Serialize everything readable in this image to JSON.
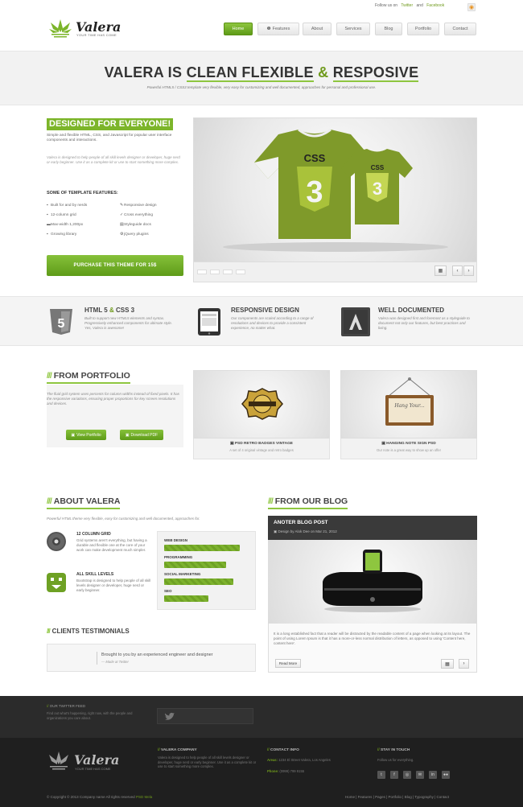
{
  "top": {
    "follow": "Follow us on",
    "twitter": "Twitter",
    "and": "and",
    "facebook": "Facebook"
  },
  "logo": {
    "name": "Valera",
    "tagline": "YOUR TIME HAS COME"
  },
  "nav": [
    "Home",
    "Features",
    "About",
    "Services",
    "Blog",
    "Portfolio",
    "Contact"
  ],
  "hero": {
    "pre": "VALERA IS ",
    "w1": "CLEAN FLEXIBLE",
    "amp": " & ",
    "w2": "RESPOSIVE",
    "subtitle": "Powerful HTML5 / CSS3 template very flexible, very easy for customizing and well documented, approaches for personal and professional use."
  },
  "intro": {
    "heading": "DESIGNED FOR EVERYONE!",
    "p1": "Simple and flexible HTML, CSS, and Javascript for popular user interface components and interactions.",
    "p2": "Valera is designed to help people of all skill levels designer or developer, huge nerd or early beginner. Use it as a complete kit or use to start something more complex.",
    "features_title": "SOME OF TEMPLATE FEATURES:",
    "features": [
      "Built for and by nerds",
      "Responsive design",
      "12-column grid",
      "Cross everything",
      "Max-width 1,200px",
      "Styleguide docs",
      "Growing library",
      "jQuery plugins"
    ],
    "buy": "PURCHASE THIS THEME FOR 15$"
  },
  "band": [
    {
      "title": "HTML 5",
      "title2": "CSS 3",
      "text": "Built to support new HTML5 elements and syntax. Progressively enhanced components for ultimate style. Yes, Valera is awesome!"
    },
    {
      "title": "RESPONSIVE DESIGN",
      "text": "Our components are scaled according to a range of resolutions and devices to provide a consistent experience, no matter what."
    },
    {
      "title": "WELL DOCUMENTED",
      "text": "Valera was designed first and foremost as a styleguide to document not only our features, but best practices and living."
    }
  ],
  "portfolio": {
    "heading": "FROM PORTFOLIO",
    "text": "The fluid grid system uses percents for column widths instead of fixed pixels. It has the responsive variations, ensuring proper proportions for key screen resolutions and devices.",
    "btn1": "View Portfolio",
    "btn2": "Download PDF",
    "items": [
      {
        "title": "PSD RETRO BADGES VINTAGE",
        "sub": "A set of 4 original vintage and retro badges"
      },
      {
        "title": "HANGING NOTE SIGN PSD",
        "sub": "Our note is a great way to show up an offer"
      }
    ],
    "sign": "Hang Your..."
  },
  "about": {
    "heading": "ABOUT VALERA",
    "sub": "Powerful HTML theme very flexible, easy for customizing and well documented, approaches for.",
    "items": [
      {
        "title": "12 COLUMN GRID",
        "text": "Grid systems aren't everything, but having a durable and flexible one at the core of your work can make development much simpler."
      },
      {
        "title": "ALL SKILL LEVELS",
        "text": "Bootstrap is designed to help people of all skill levels designer or developer, huge nerd or early beginner."
      }
    ],
    "skills": [
      {
        "name": "WEB DESIGN",
        "pct": 85
      },
      {
        "name": "PROGRAMMING",
        "pct": 70
      },
      {
        "name": "SOCIAL MARKETING",
        "pct": 78
      },
      {
        "name": "SEO",
        "pct": 50
      }
    ]
  },
  "testimonials": {
    "heading": "CLIENTS TESTIMONIALS",
    "quote": "Brought to you by an experienced engineer and designer",
    "author": "— Made at Twitter"
  },
  "blog": {
    "heading": "FROM OUR BLOG",
    "post_title": "ANOTER BLOG POST",
    "meta": "Design by Alok Dee on Mar 21, 2012",
    "text": "It is a long established fact that a reader will be distracted by the readable content of a page when looking at its layout. The point of using Lorem Ipsum is that it has a more-or-less normal distribution of letters, as opposed to using 'Content here, content here'.",
    "read_more": "Read More"
  },
  "footer": {
    "twitter_title": "OUR TWITTER FEED",
    "twitter_text": "Find out what's happening, right now, with the people and organizations you care about.",
    "company_title": "VALERA COMPANY",
    "company_text": "Valera is designed to help people of all skill levels designer or developer, huge nerd or early beginner. Use it as a complete kit or use to start something more complex.",
    "contact_title": "CONTACT INFO",
    "address_label": "Areas:",
    "address": "1234 El Street Valera, Los Angeles",
    "phone_label": "Phone:",
    "phone": "(0999) 799 9155",
    "touch_title": "STAY IN TOUCH",
    "touch_text": "Follow us for everything.",
    "social": [
      "t",
      "f",
      "◎",
      "✉",
      "in",
      "●●"
    ],
    "copyright": "© Copyright © 2013 Company name All rights reserved",
    "copyright_link": "PSD Mela",
    "links": "Home | Features | Pages | Portfolio | Blog | Typography | Contact"
  },
  "colors": {
    "accent": "#7cb52a",
    "dark": "#2b2b2b"
  }
}
